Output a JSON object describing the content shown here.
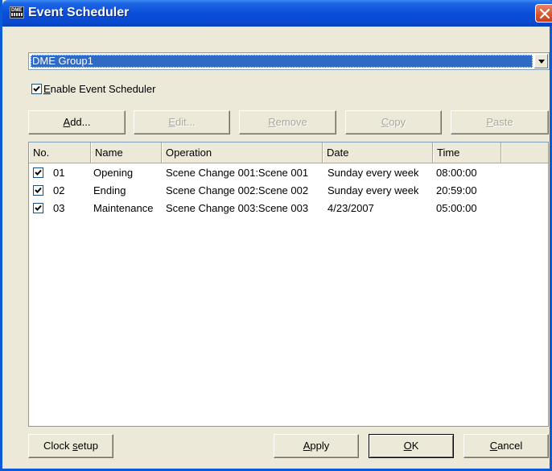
{
  "window": {
    "title": "Event Scheduler"
  },
  "group_select": {
    "value": "DME Group1"
  },
  "enable_checkbox": {
    "label_prefix": "E",
    "label_rest": "nable Event Scheduler",
    "checked": true
  },
  "toolbar": {
    "add": {
      "prefix": "",
      "mnemonic": "A",
      "rest": "dd..."
    },
    "edit": {
      "prefix": "",
      "mnemonic": "E",
      "rest": "dit..."
    },
    "remove": {
      "prefix": "",
      "mnemonic": "R",
      "rest": "emove"
    },
    "copy": {
      "prefix": "",
      "mnemonic": "C",
      "rest": "opy"
    },
    "paste": {
      "prefix": "",
      "mnemonic": "P",
      "rest": "aste"
    }
  },
  "table": {
    "columns": [
      "No.",
      "Name",
      "Operation",
      "Date",
      "Time"
    ],
    "rows": [
      {
        "checked": true,
        "no": "01",
        "name": "Opening",
        "operation": "Scene Change 001:Scene 001",
        "date": "Sunday every week",
        "time": "08:00:00"
      },
      {
        "checked": true,
        "no": "02",
        "name": "Ending",
        "operation": "Scene Change 002:Scene 002",
        "date": "Sunday every week",
        "time": "20:59:00"
      },
      {
        "checked": true,
        "no": "03",
        "name": "Maintenance",
        "operation": "Scene Change 003:Scene 003",
        "date": "4/23/2007",
        "time": "05:00:00"
      }
    ]
  },
  "footer": {
    "clock": {
      "prefix": "Clock ",
      "mnemonic": "s",
      "rest": "etup"
    },
    "apply": {
      "prefix": "",
      "mnemonic": "A",
      "rest": "pply"
    },
    "ok": {
      "prefix": "",
      "mnemonic": "O",
      "rest": "K"
    },
    "cancel": {
      "prefix": "",
      "mnemonic": "C",
      "rest": "ancel"
    }
  },
  "colors": {
    "title_bar": "#0a4ed8",
    "selection": "#316ac5",
    "close_button": "#d9532c",
    "dialog_face": "#ece9d8"
  },
  "icons": {
    "app": "dme-app-icon",
    "close": "close-icon",
    "dropdown": "chevron-down-icon",
    "check": "check-icon"
  }
}
